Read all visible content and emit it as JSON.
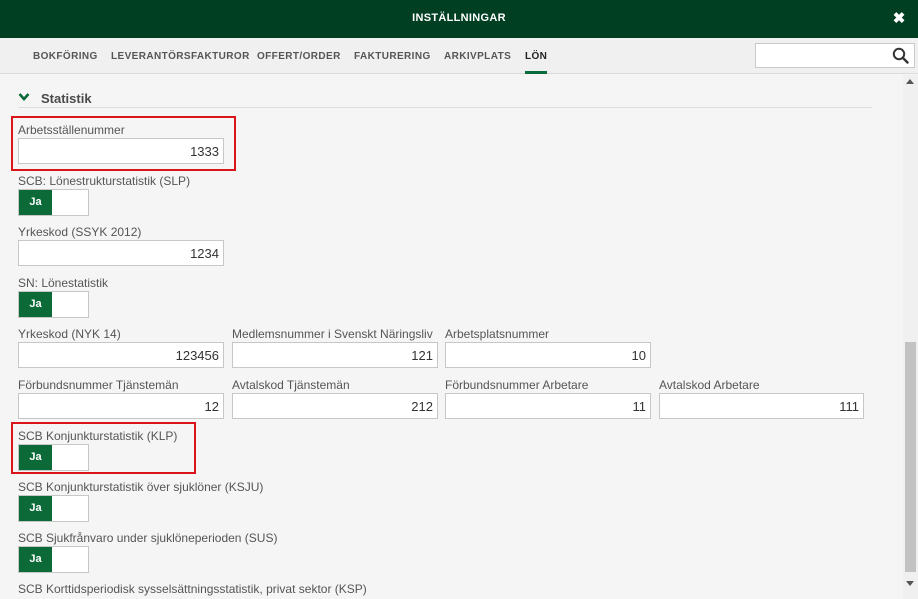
{
  "window": {
    "title": "INSTÄLLNINGAR",
    "close_glyph": "✖"
  },
  "tabs": [
    {
      "label": "BOKFÖRING"
    },
    {
      "label": "LEVERANTÖRSFAKTUROR"
    },
    {
      "label": "OFFERT/ORDER"
    },
    {
      "label": "FAKTURERING"
    },
    {
      "label": "ARKIVPLATS"
    },
    {
      "label": "LÖN",
      "active": true
    }
  ],
  "search": {
    "placeholder": "",
    "value": "",
    "icon": "search-icon"
  },
  "section": {
    "title": "Statistik",
    "expanded": true,
    "icon": "chevron-down-icon"
  },
  "fields": {
    "arbetsstallenummer": {
      "label": "Arbetsställenummer",
      "value": "1333"
    },
    "slp": {
      "label": "SCB: Lönestrukturstatistik (SLP)",
      "toggle": "Ja"
    },
    "yrkeskod_ssyk": {
      "label": "Yrkeskod (SSYK 2012)",
      "value": "1234"
    },
    "sn": {
      "label": "SN: Lönestatistik",
      "toggle": "Ja"
    },
    "yrkeskod_nyk": {
      "label": "Yrkeskod (NYK 14)",
      "value": "123456"
    },
    "medlemsnummer": {
      "label": "Medlemsnummer i Svenskt Näringsliv",
      "value": "121"
    },
    "arbetsplatsnummer": {
      "label": "Arbetsplatsnummer",
      "value": "10"
    },
    "forbund_tjm": {
      "label": "Förbundsnummer Tjänstemän",
      "value": "12"
    },
    "avtal_tjm": {
      "label": "Avtalskod Tjänstemän",
      "value": "212"
    },
    "forbund_arb": {
      "label": "Förbundsnummer Arbetare",
      "value": "11"
    },
    "avtal_arb": {
      "label": "Avtalskod Arbetare",
      "value": "111"
    },
    "klp": {
      "label": "SCB Konjunkturstatistik (KLP)",
      "toggle": "Ja"
    },
    "ksju": {
      "label": "SCB Konjunkturstatistik över sjuklöner (KSJU)",
      "toggle": "Ja"
    },
    "sus": {
      "label": "SCB Sjukfrånvaro under sjuklöneperioden (SUS)",
      "toggle": "Ja"
    },
    "ksp": {
      "label": "SCB Korttidsperiodisk sysselsättningsstatistik, privat sektor (KSP)"
    }
  },
  "colors": {
    "header_bg": "#003f22",
    "toggle_on": "#0b6a37",
    "highlight": "#d9141b"
  }
}
